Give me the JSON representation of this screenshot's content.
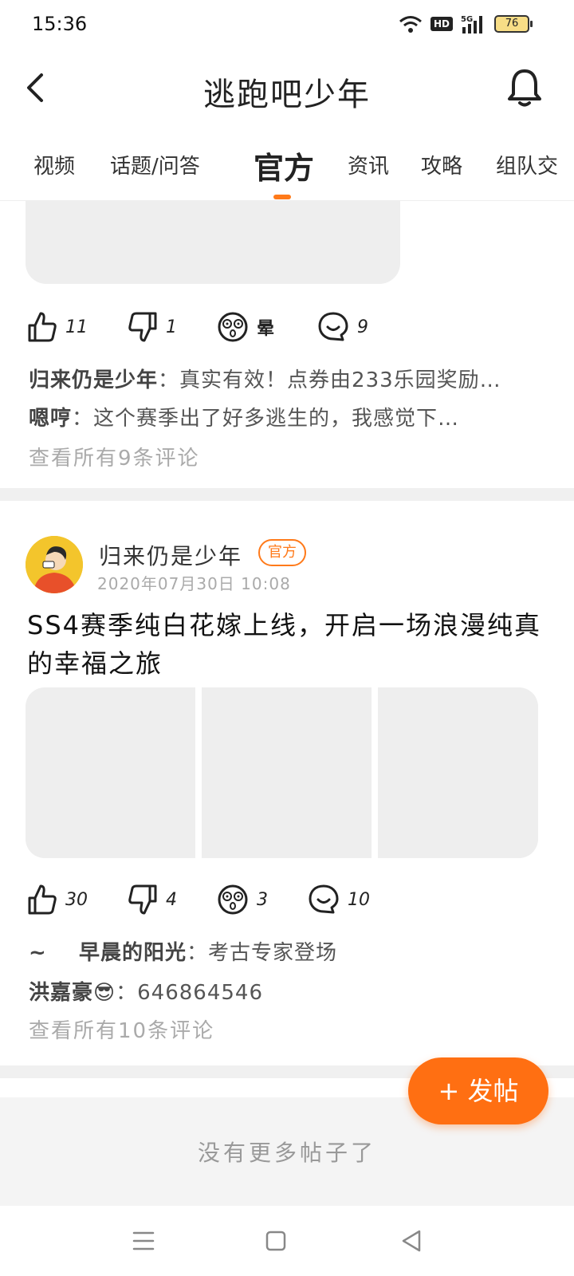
{
  "status": {
    "time": "15:36",
    "hd": "HD",
    "network": "5G",
    "battery": "76"
  },
  "header": {
    "title": "逃跑吧少年"
  },
  "tabs": [
    "视频",
    "话题/问答",
    "官方",
    "资讯",
    "攻略",
    "组队交"
  ],
  "active_tab_index": 2,
  "post1": {
    "likes": "11",
    "dislikes": "1",
    "dizzy_label": "晕",
    "comments": "9",
    "preview_comments": [
      {
        "name": "归来仍是少年",
        "sep": "：",
        "text": "真实有效！点券由233乐园奖励…"
      },
      {
        "name": "嗯哼",
        "sep": "：",
        "text": "这个赛季出了好多逃生的，我感觉下…"
      }
    ],
    "view_all": "查看所有9条评论"
  },
  "post2": {
    "author": "归来仍是少年",
    "badge": "官方",
    "time": "2020年07月30日 10:08",
    "title": "SS4赛季纯白花嫁上线，开启一场浪漫纯真的幸福之旅",
    "likes": "30",
    "dislikes": "4",
    "dizzy": "3",
    "comments": "10",
    "preview_comments": [
      {
        "name": "~    早晨的阳光",
        "sep": "：",
        "text": "考古专家登场"
      },
      {
        "name": "洪嘉豪😎",
        "sep": "：",
        "text": "646864546"
      }
    ],
    "view_all": "查看所有10条评论"
  },
  "fab": {
    "label": "+ 发帖"
  },
  "footer": {
    "no_more": "没有更多帖子了"
  },
  "colors": {
    "accent": "#ff7a1a",
    "placeholder": "#eeeeee",
    "divider": "#f0f0f0"
  }
}
